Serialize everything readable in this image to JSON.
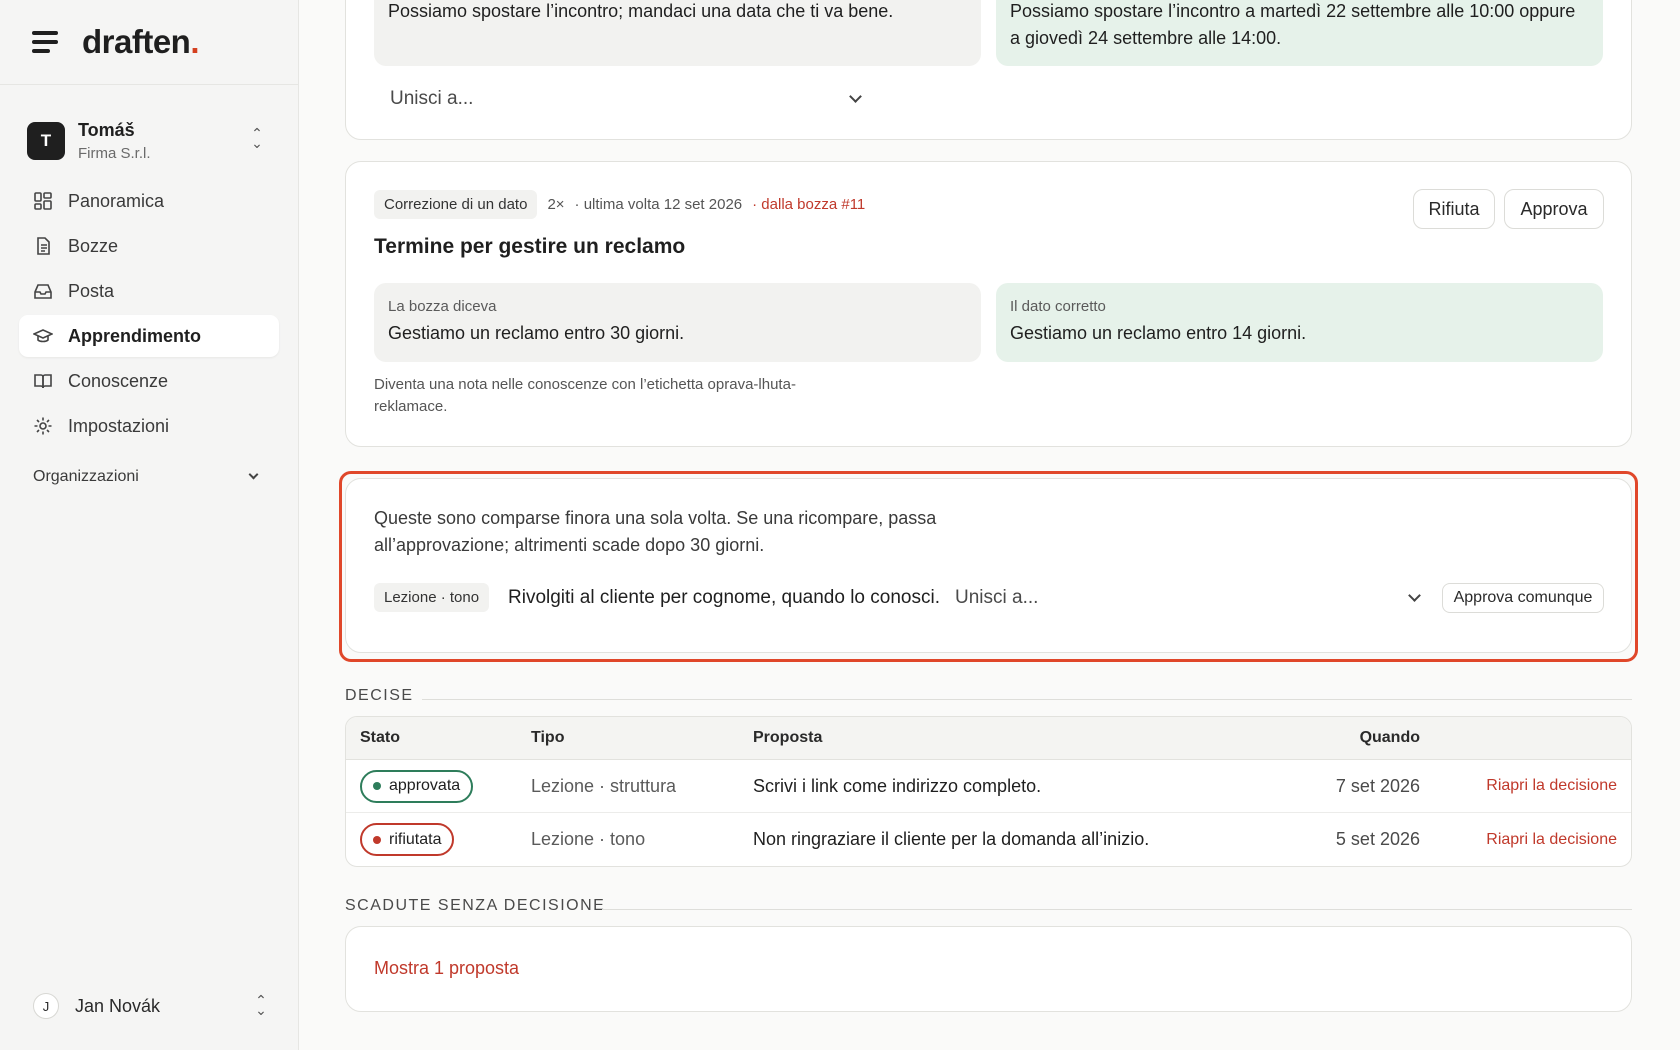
{
  "brand": {
    "name": "draften",
    "dot": "."
  },
  "account": {
    "initial": "T",
    "name": "Tomáš",
    "org": "Firma S.r.l."
  },
  "nav": {
    "items": [
      {
        "label": "Panoramica",
        "icon": "dashboard-icon"
      },
      {
        "label": "Bozze",
        "icon": "document-icon"
      },
      {
        "label": "Posta",
        "icon": "inbox-icon"
      },
      {
        "label": "Apprendimento",
        "icon": "graduation-cap-icon",
        "active": true
      },
      {
        "label": "Conoscenze",
        "icon": "book-icon"
      },
      {
        "label": "Impostazioni",
        "icon": "gear-icon"
      }
    ],
    "group_label": "Organizzazioni"
  },
  "user": {
    "initial": "J",
    "name": "Jan Novák"
  },
  "card1": {
    "left_text": "Possiamo spostare l’incontro; mandaci una data che ti va bene.",
    "right_text": "Possiamo spostare l’incontro a martedì 22 settembre alle 10:00 oppure a giovedì 24 settembre alle 14:00.",
    "merge_placeholder": "Unisci a..."
  },
  "card2": {
    "tag": "Correzione di un dato",
    "count": "2×",
    "last_time": "· ultima volta 12 set 2026",
    "source": "· dalla bozza #11",
    "title": "Termine per gestire un reclamo",
    "reject_label": "Rifiuta",
    "approve_label": "Approva",
    "left_label": "La bozza diceva",
    "left_text": "Gestiamo un reclamo entro 30 giorni.",
    "right_label": "Il dato corretto",
    "right_text": "Gestiamo un reclamo entro 14 giorni.",
    "note": "Diventa una nota nelle conoscenze con l’etichetta oprava-lhuta-reklamace."
  },
  "card3": {
    "intro": "Queste sono comparse finora una sola volta. Se una ricompare, passa all’approvazione; altrimenti scade dopo 30 giorni.",
    "tag": "Lezione · tono",
    "text": "Rivolgiti al cliente per cognome, quando lo conosci.",
    "merge_placeholder": "Unisci a...",
    "approve_anyway_label": "Approva comunque"
  },
  "decided": {
    "section_label": "DECISE",
    "headers": {
      "status": "Stato",
      "type": "Tipo",
      "proposal": "Proposta",
      "when": "Quando"
    },
    "rows": [
      {
        "status": "approvata",
        "type": "Lezione · struttura",
        "proposal": "Scrivi i link come indirizzo completo.",
        "when": "7 set 2026",
        "action": "Riapri la decisione"
      },
      {
        "status": "rifiutata",
        "type": "Lezione · tono",
        "proposal": "Non ringraziare il cliente per la domanda all’inizio.",
        "when": "5 set 2026",
        "action": "Riapri la decisione"
      }
    ]
  },
  "expired": {
    "section_label": "SCADUTE SENZA DECISIONE",
    "show_link": "Mostra 1 proposta"
  },
  "colors": {
    "accent_red": "#c0392b",
    "approved_green": "#2e7d5b",
    "highlight": "#e0472a"
  }
}
